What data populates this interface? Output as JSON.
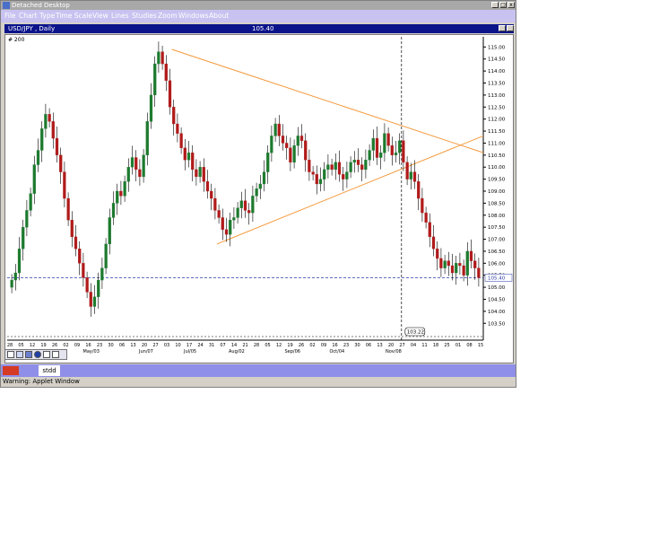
{
  "window": {
    "title": "Detached Desktop",
    "buttons": [
      "_",
      "□",
      "x"
    ]
  },
  "menu": [
    "File",
    "Chart Type",
    "Time Scale",
    "View",
    "Lines",
    "Studies",
    "Zoom",
    "Windows",
    "About"
  ],
  "chart_header": {
    "symbol": "USD/JPY , Daily",
    "price": "105.40",
    "corner": "# 200"
  },
  "colors": {
    "up": "#1d7a2e",
    "down": "#b01a1a",
    "trend": "#f39a3c",
    "panel": "#0b138a",
    "menu": "#c7c2f0",
    "taskbar": "#8f8ee8"
  },
  "chart_data": {
    "type": "candlestick",
    "ylim": [
      102.8,
      115.2
    ],
    "y_ticks": [
      "115.00",
      "114.50",
      "114.00",
      "113.50",
      "113.00",
      "112.50",
      "112.00",
      "111.50",
      "111.00",
      "110.50",
      "110.00",
      "109.50",
      "109.00",
      "108.50",
      "108.00",
      "107.50",
      "107.00",
      "106.50",
      "106.00",
      "105.50",
      "105.00",
      "104.50",
      "104.00",
      "103.50"
    ],
    "last_price_label": "105.40",
    "crosshair_label": "103.22",
    "x_days": [
      "28",
      "05",
      "12",
      "19",
      "26",
      "02",
      "09",
      "16",
      "23",
      "30",
      "06",
      "13",
      "20",
      "27",
      "03",
      "10",
      "17",
      "24",
      "31",
      "07",
      "14",
      "21",
      "28",
      "05",
      "12",
      "19",
      "26",
      "02",
      "09",
      "16",
      "23",
      "30",
      "06",
      "13",
      "20",
      "27",
      "04",
      "11",
      "18",
      "25",
      "01",
      "08",
      "15"
    ],
    "x_months": [
      "Apr/05",
      "May/03",
      "Jun/07",
      "Jul/05",
      "Aug/02",
      "Sep/06",
      "Oct/04",
      "Nov/08"
    ],
    "closes": [
      105.3,
      105.6,
      106.6,
      107.5,
      108.2,
      108.9,
      110.1,
      110.7,
      111.6,
      112.2,
      111.9,
      111.2,
      110.5,
      109.8,
      108.7,
      107.8,
      107.1,
      106.6,
      106.0,
      105.4,
      104.8,
      104.2,
      104.6,
      105.3,
      105.8,
      106.8,
      107.9,
      108.5,
      109.0,
      108.8,
      109.4,
      110.0,
      110.4,
      109.9,
      109.6,
      110.5,
      111.9,
      113.0,
      114.3,
      114.8,
      114.3,
      113.6,
      112.5,
      111.8,
      111.4,
      110.8,
      110.3,
      110.6,
      109.9,
      109.6,
      110.0,
      109.4,
      109.0,
      108.7,
      108.2,
      107.9,
      107.4,
      107.2,
      107.8,
      107.9,
      108.3,
      108.6,
      108.2,
      108.1,
      108.8,
      109.1,
      109.3,
      109.8,
      110.6,
      111.3,
      111.8,
      111.3,
      111.0,
      110.8,
      110.2,
      110.9,
      111.3,
      111.1,
      110.3,
      109.8,
      109.7,
      109.3,
      109.5,
      109.9,
      110.1,
      109.9,
      110.2,
      109.7,
      109.5,
      109.8,
      110.2,
      110.3,
      110.1,
      109.9,
      110.3,
      110.7,
      111.2,
      110.4,
      110.6,
      111.4,
      110.9,
      110.5,
      110.6,
      111.1,
      110.2,
      109.5,
      109.8,
      109.4,
      108.7,
      108.1,
      107.7,
      107.1,
      106.6,
      106.2,
      105.8,
      106.1,
      105.9,
      105.6,
      106.0,
      105.9,
      105.5,
      106.5,
      106.1,
      105.8,
      105.4
    ]
  },
  "toolbar_icons": [
    "cursor-tool",
    "line-tool",
    "indicator-tool",
    "circle-tool",
    "zoom-tool",
    "help-tool"
  ],
  "taskbar": {
    "item": "stdd"
  },
  "status": {
    "text": "Warning: Applet Window"
  }
}
